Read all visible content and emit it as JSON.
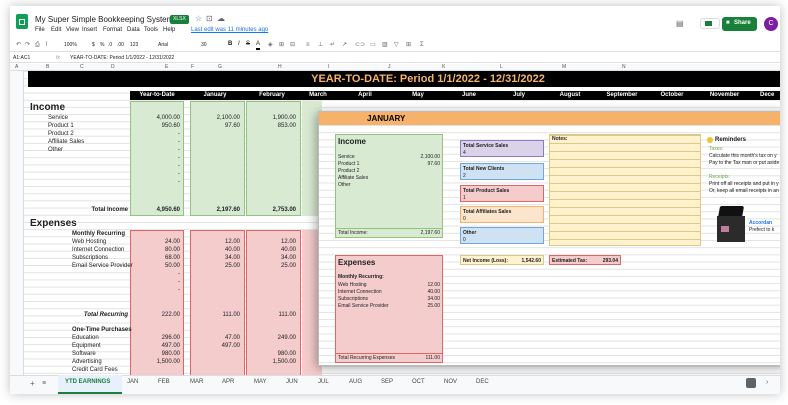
{
  "app": {
    "title": "My Super Simple Bookkeeping System",
    "badge": "XLSX",
    "last_edit": "Last edit was 11 minutes ago",
    "share": "Share",
    "avatar": "C"
  },
  "menu": [
    "File",
    "Edit",
    "View",
    "Insert",
    "Format",
    "Data",
    "Tools",
    "Help"
  ],
  "toolbar": {
    "zoom": "100%",
    "currency": "$",
    "percent": "%",
    "dec1": ".0",
    "dec2": ".00",
    "fmt": "123",
    "font": "Arial",
    "size": "30"
  },
  "formula": {
    "cell": "A1:AC1",
    "content": "YEAR-TO-DATE: Period 1/1/2022 - 12/31/2022"
  },
  "cols": [
    "A",
    "B",
    "C",
    "D",
    "E",
    "F",
    "G",
    "H",
    "I",
    "J",
    "K",
    "L",
    "M",
    "N"
  ],
  "rows": [
    "1",
    "2",
    "3",
    "4",
    "5",
    "6",
    "7",
    "8",
    "9",
    "10",
    "11",
    "12",
    "13",
    "14",
    "18",
    "19",
    "20",
    "21",
    "22",
    "23",
    "24",
    "25",
    "26",
    "27",
    "28",
    "29",
    "30",
    "31",
    "32",
    "33",
    "34",
    "35",
    "36"
  ],
  "sheet": {
    "banner": "YEAR-TO-DATE: Period 1/1/2022 - 12/31/2022",
    "months": [
      "Year-to-Date",
      "January",
      "February",
      "March",
      "April",
      "May",
      "June",
      "July",
      "August",
      "September",
      "October",
      "November",
      "Dece"
    ],
    "income_h": "Income",
    "income_items": [
      "Service",
      "Product 1",
      "Product 2",
      "Affiliate Sales",
      "Other"
    ],
    "ytd": [
      "4,000.00",
      "950.60",
      "-",
      "-",
      "-",
      "-",
      "-",
      "-",
      "-"
    ],
    "jan": [
      "2,100.00",
      "97.60"
    ],
    "feb": [
      "1,900.00",
      "853.00"
    ],
    "total_income_l": "Total Income",
    "total_income": [
      "4,950.60",
      "2,197.60",
      "2,753.00"
    ],
    "expenses_h": "Expenses",
    "monthly_h": "Monthly Recurring",
    "monthly_items": [
      "Web Hosting",
      "Internet Connection",
      "Subscriptions",
      "Email Service Provider"
    ],
    "m_ytd": [
      "24.00",
      "80.00",
      "68.00",
      "50.00",
      "-",
      "-",
      "-"
    ],
    "m_jan": [
      "12.00",
      "40.00",
      "34.00",
      "25.00"
    ],
    "m_feb": [
      "12.00",
      "40.00",
      "34.00",
      "25.00"
    ],
    "total_rec_l": "Total Recurring",
    "total_rec": [
      "222.00",
      "111.00",
      "111.00"
    ],
    "onetime_h": "One-Time Purchases",
    "onetime_items": [
      "Education",
      "Equipment",
      "Software",
      "Advertising",
      "Credit Card Fees"
    ],
    "o_ytd": [
      "296.00",
      "497.00",
      "980.00",
      "1,500.00"
    ],
    "o_jan": [
      "47.00",
      "497.00"
    ],
    "o_feb": [
      "249.00",
      "",
      "980.00",
      "1,500.00"
    ]
  },
  "overlay": {
    "title": "JANUARY",
    "income_h": "Income",
    "items": [
      "Service",
      "Product 1",
      "Product 2",
      "Affiliate Sales",
      "Other"
    ],
    "vals": [
      "2,100.00",
      "97.60"
    ],
    "total_l": "Total Income:",
    "total": "2,197.60",
    "svc_l": "Total Service Sales",
    "svc": "4",
    "clients_l": "Total New Clients",
    "clients": "2",
    "prod_l": "Total Product Sales",
    "prod": "1",
    "aff_l": "Total Affiliates Sales",
    "aff": "0",
    "other_l": "Other",
    "other": "0",
    "notes_l": "Notes:",
    "rem_h": "Reminders",
    "rem_taxes": "Taxes:",
    "rem_t1": "Calculate this month's tax on y",
    "rem_t2": "Pay to the Tax man or put aside",
    "rem_receipts": "Receipts:",
    "rem_r1": "Print off all receipts and put in y",
    "rem_r2": "Or, keep all email receipts in an",
    "acc1": "Accordan",
    "acc2": "Prefect to k",
    "exp_h": "Expenses",
    "mon_h": "Monthly Recurring:",
    "mitems": [
      "Web Hosting",
      "Internet Connection",
      "Subscriptions",
      "Email Service Provider"
    ],
    "mvals": [
      "12.00",
      "40.00",
      "34.00",
      "25.00"
    ],
    "net_l": "Net Income (Loss):",
    "net": "1,542.60",
    "tax_l": "Estimated Tax:",
    "tax": "293.04",
    "trec_l": "Total Recurring Expenses",
    "trec": "111.00"
  },
  "tabs": [
    "YTD EARNINGS",
    "JAN",
    "FEB",
    "MAR",
    "APR",
    "MAY",
    "JUN",
    "JUL",
    "AUG",
    "SEP",
    "OCT",
    "NOV",
    "DEC"
  ],
  "colors": {
    "green": "#188038",
    "banner": "#000000",
    "banner_text": "#f6b26b",
    "income_bg": "#d9ead3",
    "expense_bg": "#f4cccc",
    "notes_bg": "#fff2cc",
    "blue": "#cfe2f3",
    "purple": "#d9d2e9",
    "orange": "#fce5cd",
    "pink": "#f4cccc",
    "jan_bar": "#f6b26b"
  }
}
